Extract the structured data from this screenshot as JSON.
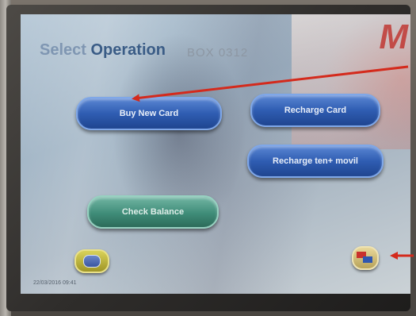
{
  "screen": {
    "title_prefix": "Select ",
    "title_main": "Operation",
    "box_code": "BOX 0312",
    "brand": "M",
    "footer_text": "22/03/2016 09:41"
  },
  "buttons": {
    "buy_new_card": "Buy New Card",
    "recharge_card": "Recharge Card",
    "recharge_ten_movil": "Recharge ten+ movil",
    "check_balance": "Check Balance"
  },
  "icons": {
    "accessibility": "accessibility-icon",
    "language": "language-flag-icon"
  },
  "colors": {
    "button_blue": "#2f5db2",
    "button_green": "#3f8c78",
    "annotation_red": "#d42a1c",
    "title": "#3a5c86"
  }
}
